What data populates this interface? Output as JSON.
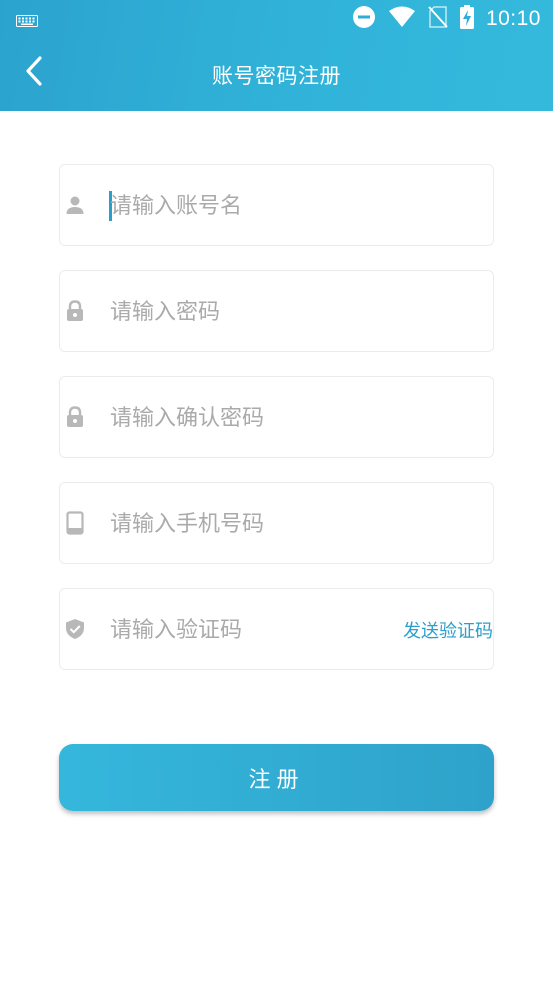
{
  "status_bar": {
    "time": "10:10",
    "icons": [
      "keyboard-icon",
      "do-not-disturb-icon",
      "wifi-icon",
      "no-sim-icon",
      "battery-charging-icon"
    ]
  },
  "toolbar": {
    "title": "账号密码注册",
    "back_icon": "chevron-left-icon"
  },
  "form": {
    "username": {
      "placeholder": "请输入账号名",
      "value": "",
      "icon": "person-icon"
    },
    "password": {
      "placeholder": "请输入密码",
      "value": "",
      "icon": "lock-icon"
    },
    "confirm_password": {
      "placeholder": "请输入确认密码",
      "value": "",
      "icon": "lock-icon"
    },
    "phone": {
      "placeholder": "请输入手机号码",
      "value": "",
      "icon": "phone-icon"
    },
    "verify_code": {
      "placeholder": "请输入验证码",
      "value": "",
      "icon": "shield-check-icon",
      "send_label": "发送验证码"
    }
  },
  "register_button": {
    "label": "注册"
  },
  "colors": {
    "accent": "#2b9fcc",
    "header_start": "#2ba3cf",
    "header_end": "#34b9dc",
    "placeholder": "#aaaaaa",
    "icon_gray": "#b8b8b8"
  }
}
